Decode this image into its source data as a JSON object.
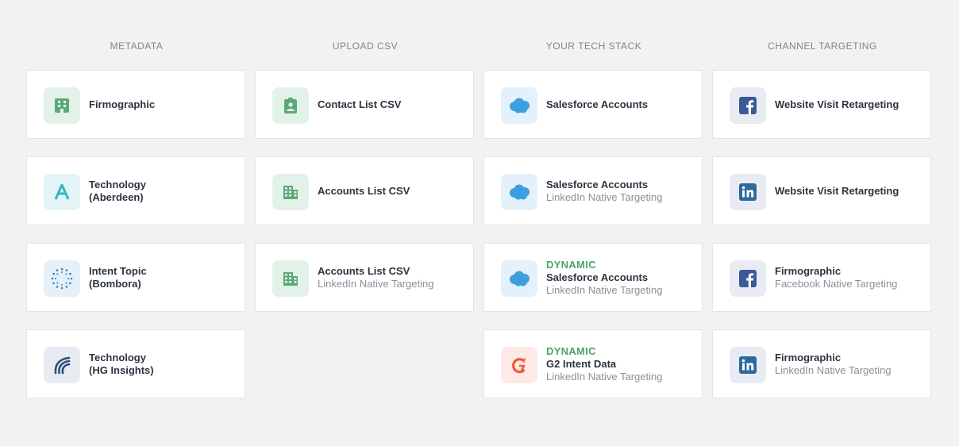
{
  "columns": [
    {
      "header": "METADATA",
      "cards": [
        {
          "title": "Firmographic",
          "icon": "firmographic-building-icon"
        },
        {
          "title": "Technology",
          "title2": "(Aberdeen)",
          "icon": "aberdeen-logo-icon"
        },
        {
          "title": "Intent Topic",
          "title2": "(Bombora)",
          "icon": "bombora-logo-icon"
        },
        {
          "title": "Technology",
          "title2": "(HG Insights)",
          "icon": "hg-insights-logo-icon"
        }
      ]
    },
    {
      "header": "UPLOAD CSV",
      "cards": [
        {
          "title": "Contact List CSV",
          "icon": "contact-badge-icon"
        },
        {
          "title": "Accounts List CSV",
          "icon": "office-building-icon"
        },
        {
          "title": "Accounts List CSV",
          "sub": "LinkedIn Native Targeting",
          "icon": "office-building-icon"
        }
      ]
    },
    {
      "header": "YOUR TECH STACK",
      "cards": [
        {
          "title": "Salesforce Accounts",
          "icon": "salesforce-cloud-icon"
        },
        {
          "title": "Salesforce Accounts",
          "sub": "LinkedIn Native Targeting",
          "icon": "salesforce-cloud-icon"
        },
        {
          "dynamic": "DYNAMIC",
          "title": "Salesforce Accounts",
          "sub": "LinkedIn Native Targeting",
          "icon": "salesforce-cloud-icon"
        },
        {
          "dynamic": "DYNAMIC",
          "title": "G2 Intent Data",
          "sub": "LinkedIn Native Targeting",
          "icon": "g2-logo-icon"
        }
      ]
    },
    {
      "header": "CHANNEL TARGETING",
      "cards": [
        {
          "title": "Website Visit Retargeting",
          "icon": "facebook-icon"
        },
        {
          "title": "Website Visit Retargeting",
          "icon": "linkedin-icon"
        },
        {
          "title": "Firmographic",
          "sub": "Facebook Native Targeting",
          "icon": "facebook-icon"
        },
        {
          "title": "Firmographic",
          "sub": "LinkedIn Native Targeting",
          "icon": "linkedin-icon"
        }
      ]
    }
  ],
  "colors": {
    "green": "#5da877",
    "salesforce": "#3d9fe0",
    "facebook": "#3b5998",
    "linkedin": "#2b6a9e",
    "g2": "#ee5a3a",
    "dynamic": "#4aa36a"
  }
}
